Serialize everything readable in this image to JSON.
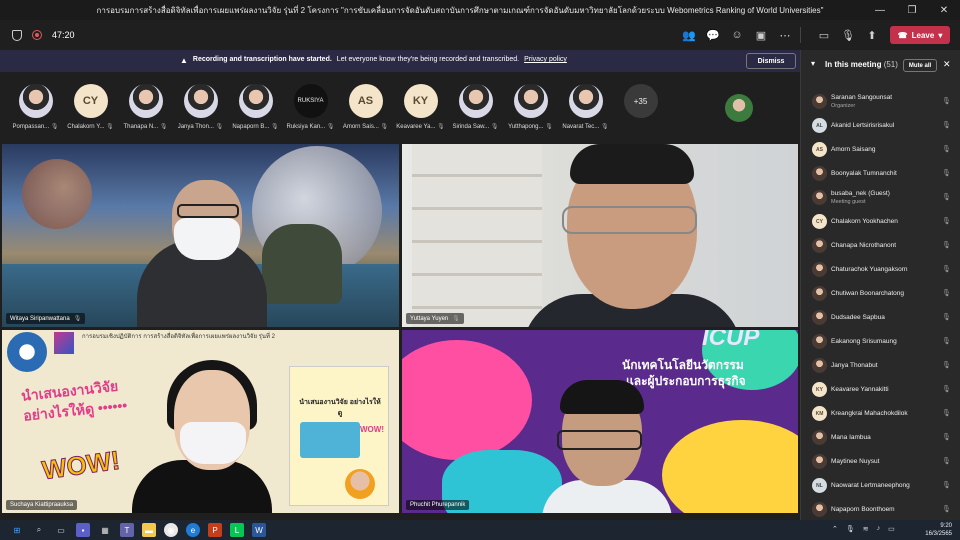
{
  "window": {
    "title": "การอบรมการสร้างสื่อดิจิทัลเพื่อการเผยแพร่ผลงานวิจัย รุ่นที่ 2 โครงการ \"การขับเคลื่อนการจัดอันดับสถาบันการศึกษาตามเกณฑ์การจัดอันดับมหาวิทยาลัยโลกด้วยระบบ Webometrics Ranking of World Universities\"",
    "minimize": "—",
    "maximize": "❐",
    "close": "✕"
  },
  "toolbar": {
    "timer": "47:20",
    "leave_label": "Leave"
  },
  "banner": {
    "warning_icon": "▲",
    "bold_text": "Recording and transcription have started.",
    "text": "Let everyone know they're being recorded and transcribed.",
    "link": "Privacy policy",
    "dismiss": "Dismiss"
  },
  "strip": [
    {
      "name": "Pompassan...",
      "type": "photo"
    },
    {
      "name": "Chalakorn Y...",
      "type": "init",
      "initials": "CY"
    },
    {
      "name": "Thanapa N...",
      "type": "photo"
    },
    {
      "name": "Janya Thon...",
      "type": "photo"
    },
    {
      "name": "Napaporn B...",
      "type": "photo"
    },
    {
      "name": "Ruksiya Kan...",
      "type": "dark",
      "initials": "RUKSIYA"
    },
    {
      "name": "Amorn Sais...",
      "type": "init",
      "initials": "AS"
    },
    {
      "name": "Keavaree Ya...",
      "type": "init",
      "initials": "KY"
    },
    {
      "name": "Sirinda Saw...",
      "type": "photo"
    },
    {
      "name": "Yutthapong...",
      "type": "photo"
    },
    {
      "name": "Navarat Tec...",
      "type": "photo"
    },
    {
      "name": "",
      "type": "more",
      "initials": "+35"
    }
  ],
  "videos": {
    "v1_name": "Witaya Siripanwattana",
    "v2_name": "Yuttaya Yuyen",
    "v3_name": "Suchaya Kiattipraauksa",
    "v4_name": "Phuchit Phurepannik",
    "v3_header": "การอบรมเชิงปฏิบัติการ การสร้างสื่อดิจิทัลเพื่อการเผยแพร่ผลงานวิจัย รุ่นที่ 2",
    "v3_big_text": "นำเสนองานวิจัยอย่างไรให้ดู ••••••",
    "v3_wow": "WOW!",
    "v3_poster_caption": "นำเสนองานวิจัย อย่างไรให้ดู",
    "v3_poster_wow": "WOW!",
    "v4_logo": "ICUP",
    "v4_line1": "นักเทคโนโลยีนวัตกรรม",
    "v4_line2": "และผู้ประกอบการธุรกิจ"
  },
  "panel": {
    "title": "In this meeting",
    "count": "(51)",
    "mute_all": "Mute all",
    "close": "✕",
    "participants": [
      {
        "name": "Saranan Sangounsat",
        "sub": "Organizer",
        "av": "ph"
      },
      {
        "name": "Akanid Lertsirisrisakul",
        "sub": "",
        "av": "gr",
        "initials": "AL"
      },
      {
        "name": "Amorn Saisang",
        "sub": "",
        "av": "in",
        "initials": "AS"
      },
      {
        "name": "Boonyalak Tumnanchit",
        "sub": "",
        "av": "ph"
      },
      {
        "name": "busaba_nek (Guest)",
        "sub": "Meeting guest",
        "av": "ph"
      },
      {
        "name": "Chalakorn Yookhachen",
        "sub": "",
        "av": "in",
        "initials": "CY"
      },
      {
        "name": "Chanapa Nicrothanont",
        "sub": "",
        "av": "ph"
      },
      {
        "name": "Chaturachok Yuangaksorn",
        "sub": "",
        "av": "ph"
      },
      {
        "name": "Chutiwan Boonarchatong",
        "sub": "",
        "av": "ph"
      },
      {
        "name": "Dudsadee Sapbua",
        "sub": "",
        "av": "ph"
      },
      {
        "name": "Eakanong Srisumaung",
        "sub": "",
        "av": "ph"
      },
      {
        "name": "Janya Thonabut",
        "sub": "",
        "av": "ph"
      },
      {
        "name": "Keavaree Yannakitti",
        "sub": "",
        "av": "in",
        "initials": "KY"
      },
      {
        "name": "Kreangkrai Mahachokdilok",
        "sub": "",
        "av": "in",
        "initials": "KM"
      },
      {
        "name": "Mana Iambua",
        "sub": "",
        "av": "ph"
      },
      {
        "name": "Maytinee Nuysut",
        "sub": "",
        "av": "ph"
      },
      {
        "name": "Naowarat Lertmaneephong",
        "sub": "",
        "av": "gr",
        "initials": "NL"
      },
      {
        "name": "Napaporn Boonthoem",
        "sub": "",
        "av": "ph"
      }
    ]
  },
  "taskbar": {
    "time": "9:20",
    "date": "16/3/2565"
  },
  "colors": {
    "leave": "#c4314b",
    "banner": "#2b2a45",
    "accent": "#8b8ff0"
  }
}
